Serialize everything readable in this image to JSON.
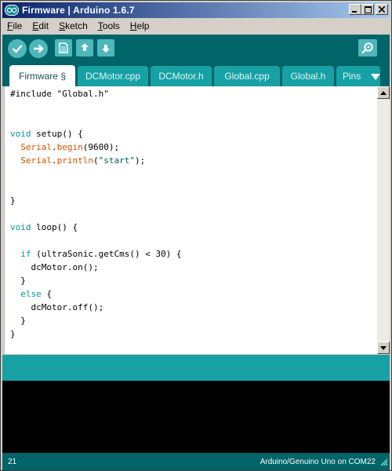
{
  "window": {
    "title": "Firmware | Arduino 1.6.7",
    "controls": [
      "minimize",
      "maximize",
      "close"
    ]
  },
  "menu": {
    "file": {
      "underline": "F",
      "rest": "ile"
    },
    "edit": {
      "underline": "E",
      "rest": "dit"
    },
    "sketch": {
      "underline": "S",
      "rest": "ketch"
    },
    "tools": {
      "underline": "T",
      "rest": "ools"
    },
    "help": {
      "underline": "H",
      "rest": "elp"
    }
  },
  "toolbar": {
    "icons": [
      "check-icon",
      "arrow-right-icon",
      "new-file-icon",
      "open-icon",
      "save-icon",
      "serial-monitor-icon"
    ]
  },
  "tabs": [
    {
      "label": "Firmware §",
      "active": true
    },
    {
      "label": "DCMotor.cpp",
      "active": false
    },
    {
      "label": "DCMotor.h",
      "active": false
    },
    {
      "label": "Global.cpp",
      "active": false
    },
    {
      "label": "Global.h",
      "active": false
    },
    {
      "label": "Pins",
      "active": false
    }
  ],
  "code": {
    "l1": "#include \"Global.h\"",
    "l4_kw": "void",
    "l4_rest": " setup() {",
    "l5_obj": "Serial",
    "l5_dot": ".",
    "l5_fn": "begin",
    "l5_rest": "(9600);",
    "l6_obj": "Serial",
    "l6_dot": ".",
    "l6_fn": "println",
    "l6_open": "(",
    "l6_str": "\"start\"",
    "l6_close": ");",
    "l9": "}",
    "l11_kw": "void",
    "l11_rest": " loop() {",
    "l13_kw": "if",
    "l13_rest": " (ultraSonic.getCms() < 30) {",
    "l14": "    dcMotor.on();",
    "l15": "  }",
    "l16_kw": "else",
    "l16_rest": " {",
    "l17": "    dcMotor.off();",
    "l18": "  }",
    "l19": "}"
  },
  "footer": {
    "line": "21",
    "board": "Arduino/Genuino Uno on COM22"
  },
  "colors": {
    "toolbar_bg": "#006468",
    "tab_bg": "#17a1a5",
    "button_bg": "#4db7bb",
    "keyword": "#00979c",
    "function": "#d35400"
  }
}
